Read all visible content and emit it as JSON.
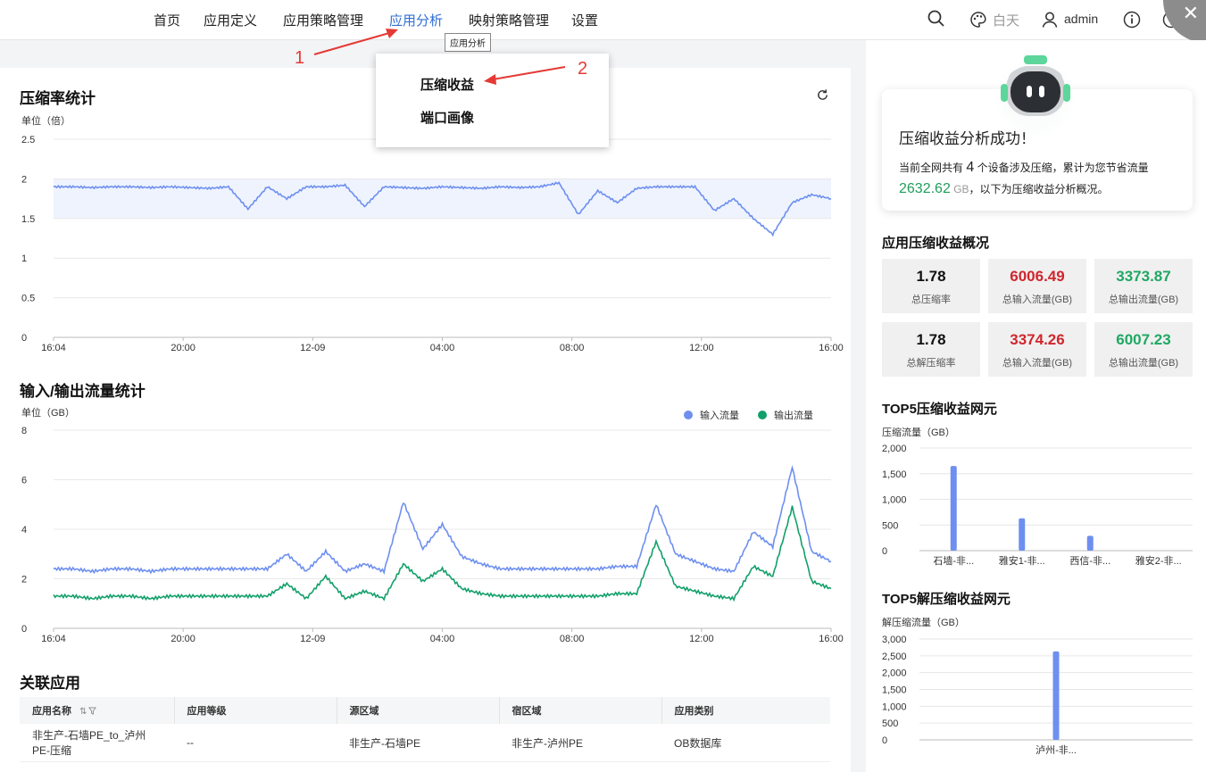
{
  "nav": {
    "items": [
      "首页",
      "应用定义",
      "应用策略管理",
      "应用分析",
      "映射策略管理",
      "设置"
    ],
    "active_index": 3,
    "tooltip": "应用分析",
    "theme_label": "白天",
    "user": "admin"
  },
  "dropdown": {
    "items": [
      "压缩收益",
      "端口画像"
    ]
  },
  "annotations": [
    "1",
    "2"
  ],
  "compression_chart": {
    "title": "压缩率统计",
    "unit": "单位（倍）",
    "y_ticks": [
      "0",
      "0.5",
      "1",
      "1.5",
      "2",
      "2.5"
    ],
    "x_ticks": [
      "16:04",
      "20:00",
      "12-09",
      "04:00",
      "08:00",
      "12:00",
      "16:00"
    ]
  },
  "traffic_chart": {
    "title": "输入/输出流量统计",
    "unit": "单位（GB）",
    "y_ticks": [
      "0",
      "2",
      "4",
      "6",
      "8"
    ],
    "x_ticks": [
      "16:04",
      "20:00",
      "12-09",
      "04:00",
      "08:00",
      "12:00",
      "16:00"
    ],
    "legend": [
      "输入流量",
      "输出流量"
    ]
  },
  "related_apps": {
    "title": "关联应用",
    "columns": [
      "应用名称",
      "应用等级",
      "源区域",
      "宿区域",
      "应用类别"
    ],
    "rows": [
      {
        "name_line1": "非生产-石墙PE_to_泸州",
        "name_line2": "PE-压缩",
        "level": "--",
        "src": "非生产-石墙PE",
        "dst": "非生产-泸州PE",
        "category": "OB数据库"
      }
    ]
  },
  "success_card": {
    "title": "压缩收益分析成功！",
    "desc_prefix": "当前全网共有",
    "device_count": "4",
    "desc_mid": "个设备涉及压缩，累计为您节省流量",
    "saved": "2632.62",
    "saved_unit": "GB",
    "desc_suffix": "，以下为压缩收益分析概况。"
  },
  "overview": {
    "title": "应用压缩收益概况",
    "stats": [
      {
        "value": "1.78",
        "label": "总压缩率"
      },
      {
        "value": "6006.49",
        "label": "总输入流量(GB)"
      },
      {
        "value": "3373.87",
        "label": "总输出流量(GB)"
      },
      {
        "value": "1.78",
        "label": "总解压缩率"
      },
      {
        "value": "3374.26",
        "label": "总输入流量(GB)"
      },
      {
        "value": "6007.23",
        "label": "总输出流量(GB)"
      }
    ]
  },
  "top5_comp": {
    "title": "TOP5压缩收益网元",
    "unit": "压缩流量（GB）",
    "y_ticks": [
      "0",
      "500",
      "1,000",
      "1,500",
      "2,000"
    ]
  },
  "top5_decomp": {
    "title": "TOP5解压缩收益网元",
    "unit": "解压缩流量（GB）",
    "y_ticks": [
      "0",
      "500",
      "1,000",
      "1,500",
      "2,000",
      "2,500",
      "3,000"
    ]
  },
  "colors": {
    "accent": "#2f6fd6",
    "input_series": "#6e8ff0",
    "output_series": "#12a06a",
    "red": "#d0262e",
    "green": "#1ea863"
  },
  "chart_data": [
    {
      "type": "line",
      "title": "压缩率统计",
      "ylabel": "单位（倍）",
      "ylim": [
        0,
        2.5
      ],
      "x": [
        "16:04",
        "20:00",
        "12-09",
        "04:00",
        "08:00",
        "12:00",
        "16:00"
      ],
      "series": [
        {
          "values": [
            1.9,
            1.9,
            1.89,
            1.9,
            1.9,
            1.89,
            1.9,
            1.89,
            1.88,
            1.9,
            1.62,
            1.9,
            1.75,
            1.9,
            1.9,
            1.92,
            1.65,
            1.9,
            1.89,
            1.88,
            1.9,
            1.89,
            1.88,
            1.9,
            1.89,
            1.9,
            1.95,
            1.55,
            1.85,
            1.7,
            1.88,
            1.9,
            1.9,
            1.9,
            1.6,
            1.75,
            1.5,
            1.3,
            1.7,
            1.8,
            1.75
          ]
        }
      ]
    },
    {
      "type": "line",
      "title": "输入/输出流量统计",
      "ylabel": "单位（GB）",
      "ylim": [
        0,
        8
      ],
      "x": [
        "16:04",
        "20:00",
        "12-09",
        "04:00",
        "08:00",
        "12:00",
        "16:00"
      ],
      "series": [
        {
          "name": "输入流量",
          "values": [
            2.4,
            2.4,
            2.3,
            2.4,
            2.4,
            2.3,
            2.4,
            2.4,
            2.4,
            2.4,
            2.4,
            2.4,
            3.0,
            2.3,
            3.1,
            2.3,
            2.6,
            2.3,
            5.1,
            3.2,
            4.2,
            2.9,
            2.6,
            2.4,
            2.4,
            2.4,
            2.4,
            2.4,
            2.4,
            2.5,
            2.5,
            5.0,
            3.0,
            2.7,
            2.4,
            2.3,
            3.9,
            3.3,
            6.5,
            3.1,
            2.7
          ]
        },
        {
          "name": "输出流量",
          "values": [
            1.3,
            1.3,
            1.2,
            1.3,
            1.3,
            1.2,
            1.3,
            1.3,
            1.3,
            1.3,
            1.3,
            1.3,
            1.8,
            1.2,
            2.1,
            1.2,
            1.5,
            1.2,
            2.6,
            1.9,
            2.4,
            1.6,
            1.4,
            1.3,
            1.3,
            1.3,
            1.3,
            1.3,
            1.3,
            1.4,
            1.4,
            3.5,
            1.7,
            1.5,
            1.3,
            1.2,
            2.5,
            2.1,
            4.9,
            1.9,
            1.6
          ]
        }
      ]
    },
    {
      "type": "bar",
      "title": "TOP5压缩收益网元",
      "ylabel": "压缩流量（GB）",
      "ylim": [
        0,
        2000
      ],
      "categories": [
        "石墙-非...",
        "雅安1-非...",
        "西信-非...",
        "雅安2-非..."
      ],
      "values": [
        1650,
        630,
        290,
        0
      ]
    },
    {
      "type": "bar",
      "title": "TOP5解压缩收益网元",
      "ylabel": "解压缩流量（GB）",
      "ylim": [
        0,
        3000
      ],
      "categories": [
        "泸州-非..."
      ],
      "values": [
        2630
      ]
    }
  ]
}
